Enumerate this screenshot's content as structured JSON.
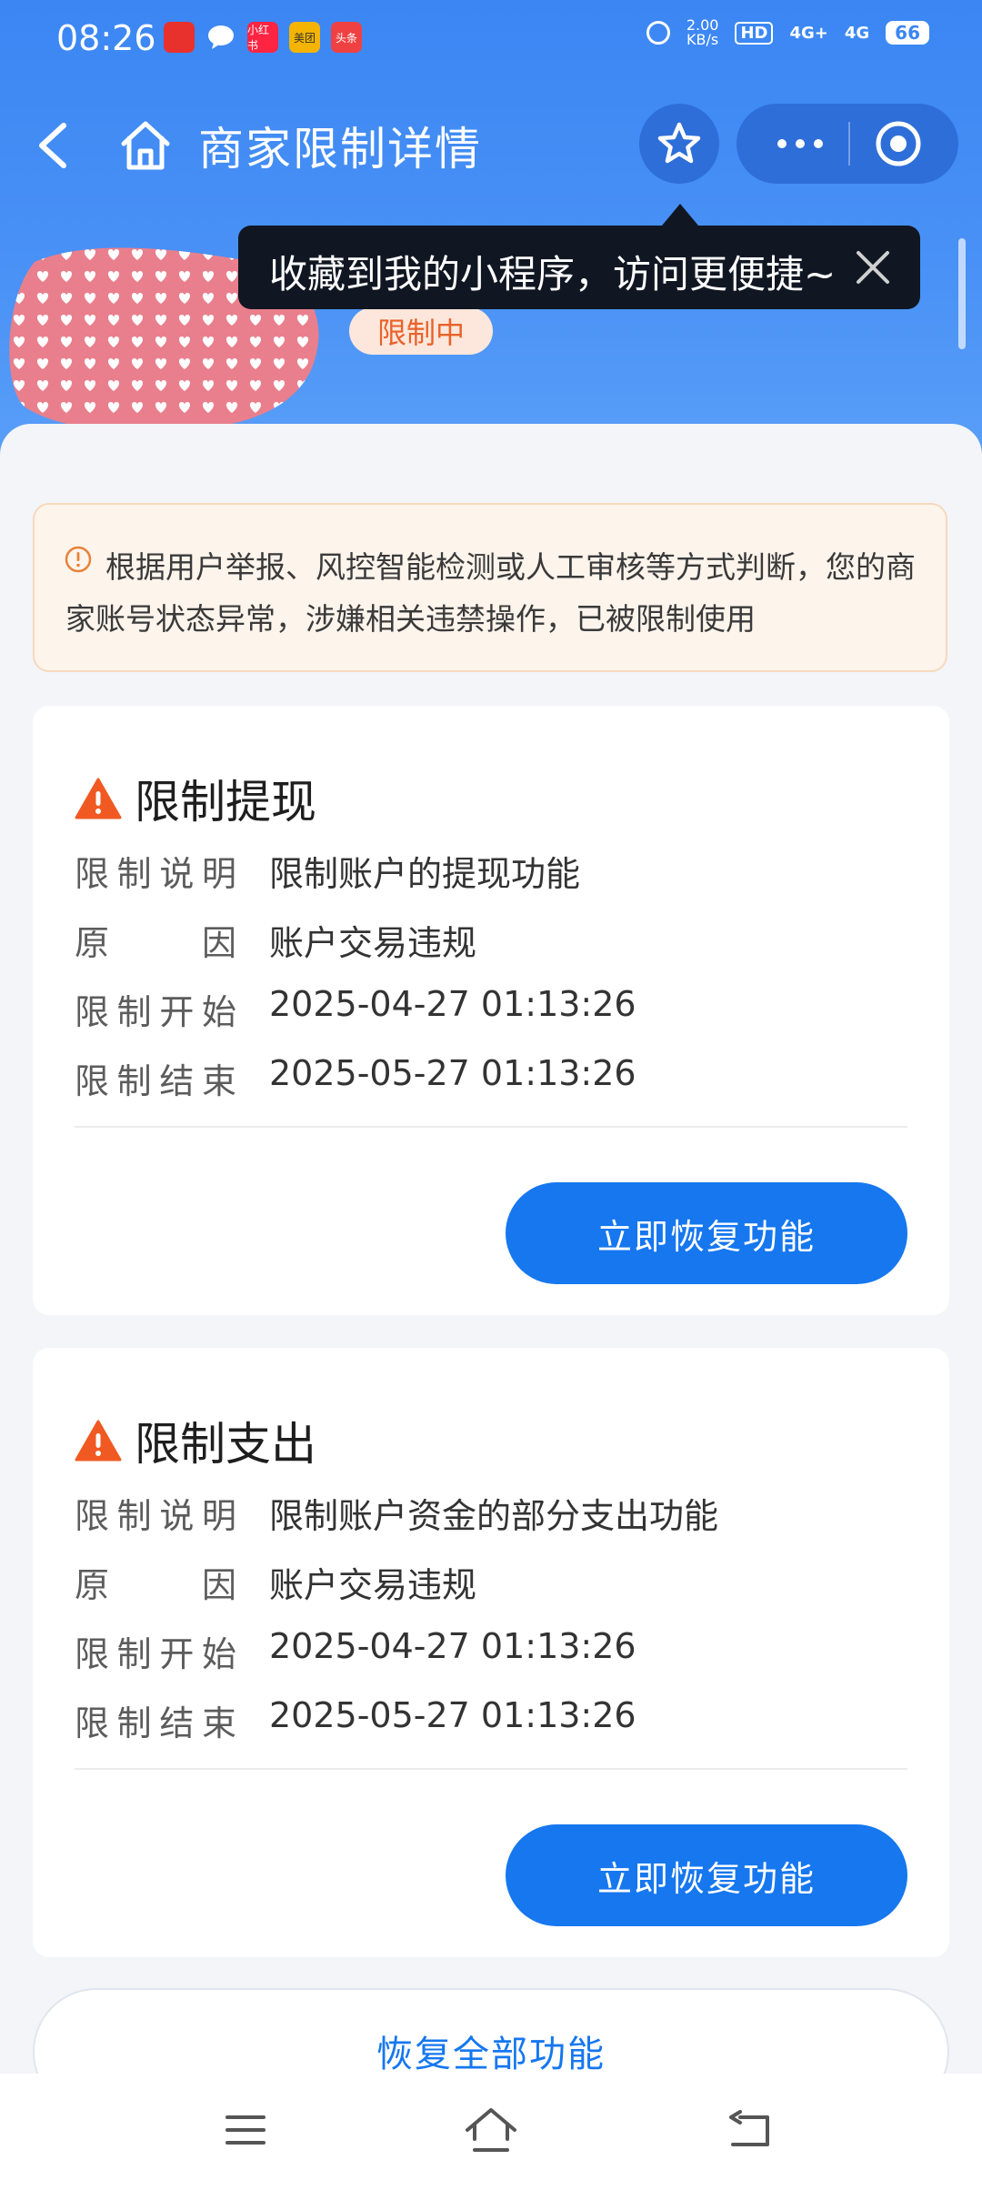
{
  "status_bar": {
    "time": "08:26",
    "app_icons": [
      {
        "name": "app-notification-1",
        "label": "",
        "color": "#e8312c"
      },
      {
        "name": "chat-bubble-icon",
        "label": "",
        "color": "#ffffff"
      },
      {
        "name": "xiaohongshu-icon",
        "label": "小红书",
        "color": "#ff2442"
      },
      {
        "name": "meituan-icon",
        "label": "美团",
        "color": "#f5b400"
      },
      {
        "name": "toutiao-icon",
        "label": "头条",
        "color": "#f04142"
      }
    ],
    "net_speed_value": "2.00",
    "net_speed_unit": "KB/s",
    "hd_label": "HD",
    "signal_1": "4G+",
    "signal_2": "4G",
    "battery": "66"
  },
  "nav": {
    "title": "商家限制详情"
  },
  "tooltip": {
    "text": "收藏到我的小程序，访问更便捷~"
  },
  "merchant": {
    "status": "限制中"
  },
  "notice": {
    "text": "根据用户举报、风控智能检测或人工审核等方式判断，您的商家账号状态异常，涉嫌相关违禁操作，已被限制使用"
  },
  "labels": {
    "desc": "限制说明",
    "reason": "原因",
    "start": "限制开始",
    "end": "限制结束"
  },
  "restrictions": [
    {
      "title": "限制提现",
      "desc": "限制账户的提现功能",
      "reason": "账户交易违规",
      "start": "2025-04-27 01:13:26",
      "end": "2025-05-27 01:13:26",
      "button": "立即恢复功能"
    },
    {
      "title": "限制支出",
      "desc": "限制账户资金的部分支出功能",
      "reason": "账户交易违规",
      "start": "2025-04-27 01:13:26",
      "end": "2025-05-27 01:13:26",
      "button": "立即恢复功能"
    }
  ],
  "restore_all": "恢复全部功能",
  "colors": {
    "brand_blue": "#1677ef",
    "header_blue": "#3b86f3",
    "warning_orange": "#f05a22",
    "status_pill_text": "#e8622a"
  }
}
